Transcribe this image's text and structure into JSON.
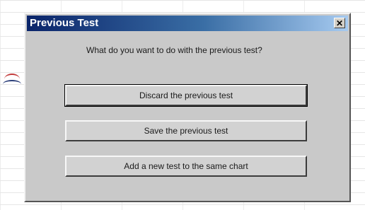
{
  "dialog": {
    "title": "Previous Test",
    "close_symbol": "✕",
    "question": "What do you want to do with the previous test?",
    "buttons": [
      {
        "label": "Discard the previous test"
      },
      {
        "label": "Save the previous test"
      },
      {
        "label": "Add a new test to the same chart"
      }
    ]
  },
  "colors": {
    "titlebar_start": "#0a246a",
    "titlebar_end": "#a6caf0",
    "dialog_face": "#c9c9c9"
  }
}
